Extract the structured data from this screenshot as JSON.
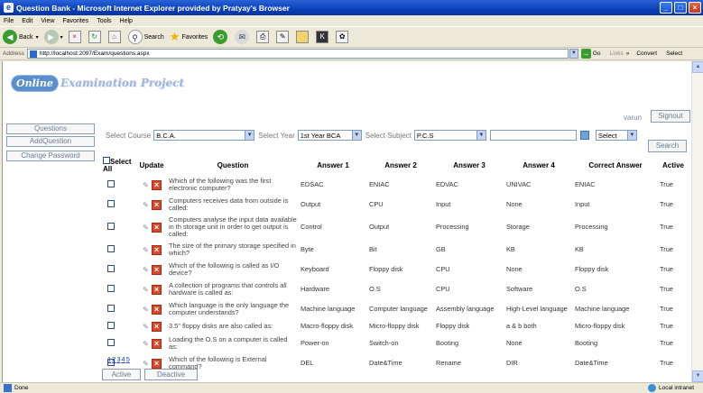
{
  "window": {
    "title": "Question Bank - Microsoft Internet Explorer provided by Pratyay's Browser"
  },
  "menu": [
    "File",
    "Edit",
    "View",
    "Favorites",
    "Tools",
    "Help"
  ],
  "toolbar": {
    "back": "Back",
    "search": "Search",
    "favorites": "Favorites"
  },
  "address": {
    "label": "Address",
    "url": "http://localhost:2097/Exam/questions.aspx",
    "go": "Go",
    "links": "Links",
    "convert": "Convert",
    "select": "Select"
  },
  "status": {
    "left": "Done",
    "zone": "Local intranet"
  },
  "logo": {
    "pill": "Online",
    "text": "Examination Project"
  },
  "user": {
    "name": "varun",
    "signout": "Signout"
  },
  "nav": {
    "questions": "Questions",
    "add_question": "AddQuestion",
    "change_password": "Change Password"
  },
  "filters": {
    "course_label": "Select Course",
    "course_value": "B.C.A.",
    "year_label": "Select Year",
    "year_value": "1st Year BCA",
    "subject_label": "Select Subject",
    "subject_value": "P.C.S",
    "select_value": "Select",
    "search_button": "Search"
  },
  "table": {
    "headers": {
      "select_all": "Select All",
      "update": "Update",
      "question": "Question",
      "a1": "Answer 1",
      "a2": "Answer 2",
      "a3": "Answer 3",
      "a4": "Answer 4",
      "correct": "Correct Answer",
      "active": "Active"
    },
    "rows": [
      {
        "q": "Which of the following was the first electronic computer?",
        "a1": "EDSAC",
        "a2": "ENIAC",
        "a3": "EDVAC",
        "a4": "UNIVAC",
        "c": "ENIAC",
        "act": "True"
      },
      {
        "q": "Computers receives data from outside is called:",
        "a1": "Output",
        "a2": "CPU",
        "a3": "Input",
        "a4": "None",
        "c": "Input",
        "act": "True"
      },
      {
        "q": "Computers analyse the input data available in th storage unit in order to get output is called:",
        "a1": "Control",
        "a2": "Output",
        "a3": "Processing",
        "a4": "Storage",
        "c": "Processing",
        "act": "True"
      },
      {
        "q": "The size of the primary storage specified in which?",
        "a1": "Byte",
        "a2": "Bit",
        "a3": "GB",
        "a4": "KB",
        "c": "KB",
        "act": "True"
      },
      {
        "q": "Which of the following is called as I/O device?",
        "a1": "Keyboard",
        "a2": "Floppy disk",
        "a3": "CPU",
        "a4": "None",
        "c": "Floppy disk",
        "act": "True"
      },
      {
        "q": "A collection of programs that controls all hardware is called as:",
        "a1": "Hardware",
        "a2": "O.S",
        "a3": "CPU",
        "a4": "Software",
        "c": "O.S",
        "act": "True"
      },
      {
        "q": "Which language is the only language the computer understands?",
        "a1": "Machine language",
        "a2": "Computer language",
        "a3": "Assembly language",
        "a4": "High-Level language",
        "c": "Machine language",
        "act": "True"
      },
      {
        "q": "3.5\" floppy disks are also called as:",
        "a1": "Macro-floppy disk",
        "a2": "Micro-floppy disk",
        "a3": "Floppy disk",
        "a4": "a & b both",
        "c": "Micro-floppy disk",
        "act": "True"
      },
      {
        "q": "Loading the O.S on a computer is called as:",
        "a1": "Power-on",
        "a2": "Switch-on",
        "a3": "Booting",
        "a4": "None",
        "c": "Booting",
        "act": "True"
      },
      {
        "q": "Which of the following is External command?",
        "a1": "DEL",
        "a2": "Date&Time",
        "a3": "Rename",
        "a4": "DIR",
        "c": "Date&Time",
        "act": "True"
      }
    ]
  },
  "pager": [
    "1",
    "2",
    "3",
    "4",
    "5"
  ],
  "actions": {
    "active": "Active",
    "deactive": "Deactive"
  }
}
